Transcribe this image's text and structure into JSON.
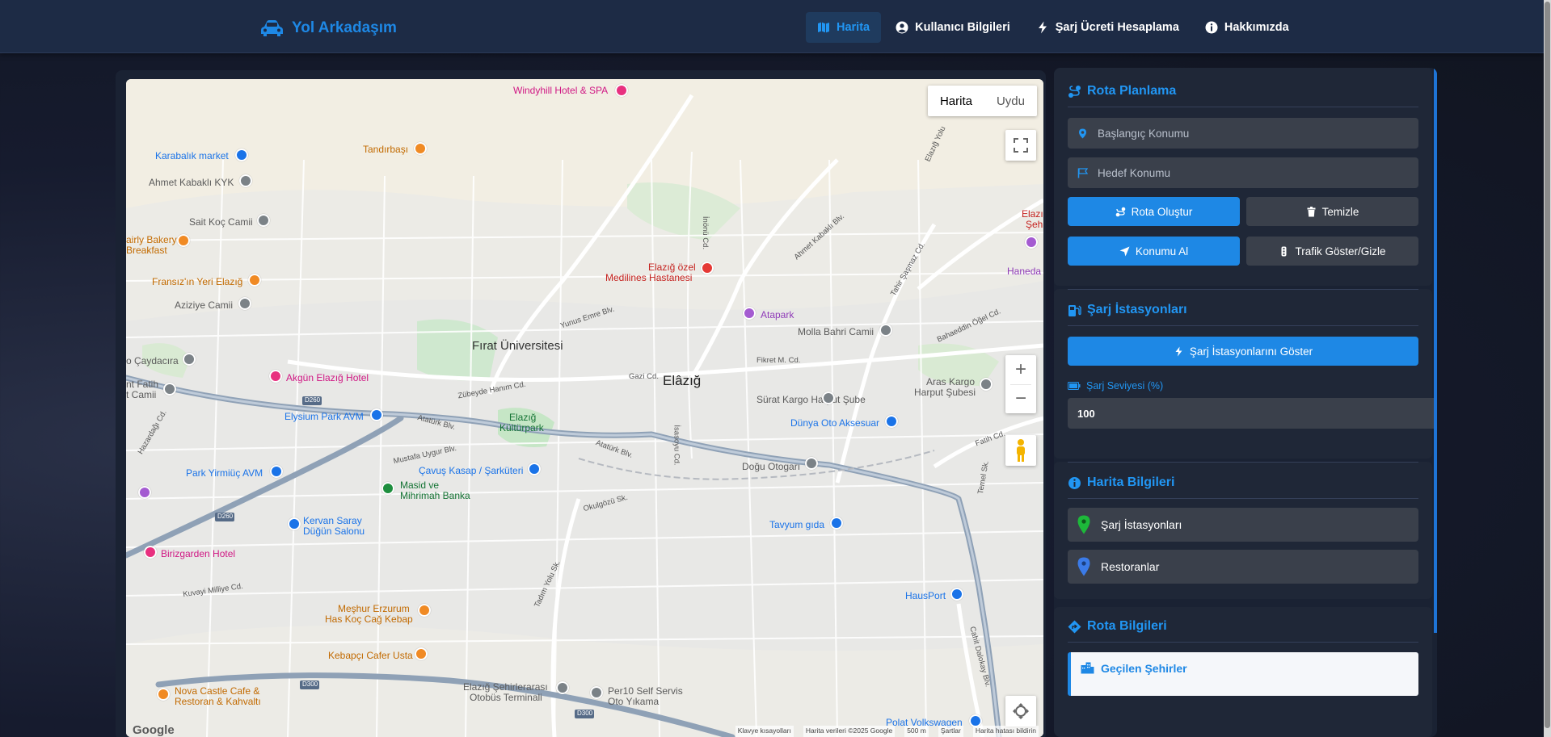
{
  "app": {
    "brand": "Yol Arkadaşım",
    "nav": [
      {
        "label": "Harita",
        "icon": "map-icon",
        "active": true
      },
      {
        "label": "Kullanıcı Bilgileri",
        "icon": "user-circle-icon",
        "active": false
      },
      {
        "label": "Şarj Ücreti Hesaplama",
        "icon": "bolt-icon",
        "active": false
      },
      {
        "label": "Hakkımızda",
        "icon": "info-circle-icon",
        "active": false
      }
    ],
    "colors": {
      "accent": "#1e88e5",
      "navbar": "#1d2b45",
      "panel": "#1f2737",
      "field": "#3a404b"
    }
  },
  "map": {
    "type_buttons": {
      "map": "Harita",
      "satellite": "Uydu"
    },
    "zoom_in": "+",
    "zoom_out": "−",
    "city": "Elâzığ",
    "district": "Fırat Üniversitesi",
    "labels": {
      "windyhill": "Windyhill Hotel & SPA",
      "tandirbasi": "Tandırbaşı",
      "karabalik": "Karabalık market",
      "kabakli": "Ahmet Kabaklı KYK",
      "saitkoc": "Sait Koç Camii",
      "fairly1": "airly Bakery",
      "fairly2": "Breakfast",
      "fransiz": "Fransız'ın Yeri Elazığ",
      "aziziye": "Aziziye Camii",
      "caydacira": "o Çaydacıra",
      "fatih1": "nt Fatih",
      "fatih2": "t Camii",
      "akgun": "Akgün Elazığ Hotel",
      "elysium": "Elysium Park AVM",
      "hospital1": "Elazığ özel",
      "hospital2": "Medilines Hastanesi",
      "atapark": "Atapark",
      "mollabahri": "Molla Bahri Camii",
      "suratkargo": "Sürat Kargo Harput Şube",
      "araskargo1": "Aras Kargo",
      "araskargo2": "Harput Şubesi",
      "dunyaoto": "Dünya Oto Aksesuar",
      "elazigpark1": "Elazığ",
      "elazigpark2": "Kültürpark",
      "cavuskasap": "Çavuş Kasap / Şarküteri",
      "parkavm": "Park Yirmiüç AVM",
      "masid1": "Masid ve",
      "masid2": "Mihrimah Banka",
      "kervan1": "Kervan Saray",
      "kervan2": "Düğün Salonu",
      "birizgarden": "Birizgarden Hotel",
      "doguotogar": "Doğu Otogarı",
      "tavyum": "Tavyum gıda",
      "meshur1": "Meşhur Erzurum",
      "meshur2": "Has Koç Cağ Kebap",
      "kebapci": "Kebapçı Cafer Usta",
      "nova1": "Nova Castle Cafe &",
      "nova2": "Restoran & Kahvaltı",
      "otobus1": "Elazığ Şehirlerarası",
      "otobus2": "Otobüs Terminali",
      "per101": "Per10 Self Servis",
      "per102": "Oto Yıkama",
      "hausport": "HausPort",
      "polat": "Polat Volkswagen",
      "haneda": "Haneda",
      "elaz1": "Elazı",
      "elaz2": "Şeh"
    },
    "streets": {
      "inonu": "İnönü Cd.",
      "kabakli_blv": "Ahmet Kabaklı Blv.",
      "yunus": "Yunus Emre Blv.",
      "gazi": "Gazi Cd.",
      "fikret": "Fikret M. Cd.",
      "zubeyde": "Zübeyde Hanım Cd.",
      "ataturk1": "Atatürk Blv.",
      "ataturk2": "Atatürk Blv.",
      "mustafa": "Mustafa Uygur Blv.",
      "hazaridag": "Hazardağı Cd.",
      "isasoyu": "İsasoyu Cd.",
      "okulgozu": "Okulgözü Sk.",
      "tadim": "Tadım Yolu Sk.",
      "kuvayi": "Kuvayi Milliye Cd.",
      "tahir": "Tahir Şaşmaz Cd.",
      "bahaeddin": "Bahaeddin Öğel Cd.",
      "fatihcd": "Fatih Cd.",
      "temel": "Temel Sk.",
      "cahit": "Cahit Dalokay Blv.",
      "elaziyolu": "Elazığ Yolu",
      "d260a": "D260",
      "d260b": "D260",
      "d300a": "D300",
      "d300b": "D300"
    },
    "footer": {
      "shortcuts": "Klavye kısayolları",
      "data": "Harita verileri ©2025 Google",
      "scale": "500 m",
      "terms": "Şartlar",
      "report": "Harita hatası bildirin"
    },
    "google": "Google"
  },
  "sidebar": {
    "route": {
      "title": "Rota Planlama",
      "start_placeholder": "Başlangıç Konumu",
      "end_placeholder": "Hedef Konumu",
      "create": "Rota Oluştur",
      "clear": "Temizle",
      "locate": "Konumu Al",
      "traffic": "Trafik Göster/Gizle"
    },
    "charging": {
      "title": "Şarj İstasyonları",
      "show": "Şarj İstasyonlarını Göster",
      "level_label": "Şarj Seviyesi (%)",
      "level_value": "100"
    },
    "legend": {
      "title": "Harita Bilgileri",
      "items": [
        {
          "label": "Şarj İstasyonları",
          "color": "#1db83a"
        },
        {
          "label": "Restoranlar",
          "color": "#3b7be8"
        }
      ]
    },
    "route_info": {
      "title": "Rota Bilgileri",
      "cities": "Geçilen Şehirler"
    }
  }
}
